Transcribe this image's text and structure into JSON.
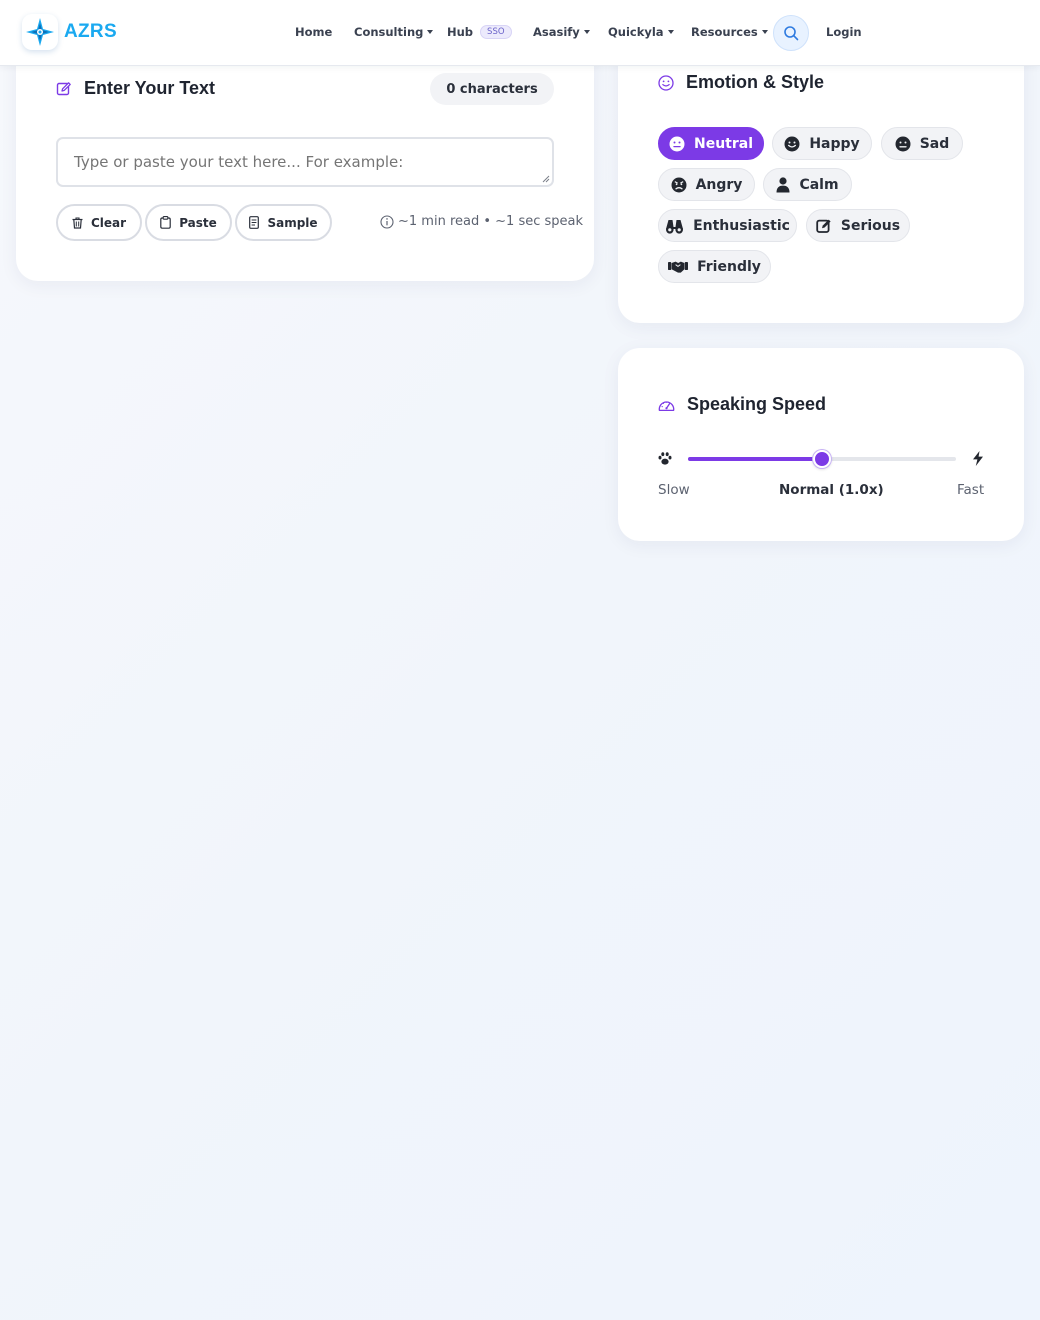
{
  "brand": {
    "name": "AZRS"
  },
  "nav": {
    "home": "Home",
    "consulting": "Consulting",
    "hub": "Hub",
    "hub_badge": "SSO",
    "asasify": "Asasify",
    "quickyla": "Quickyla",
    "resources": "Resources",
    "login": "Login"
  },
  "text_card": {
    "title": "Enter Your Text",
    "char_count": "0 characters",
    "placeholder": "Type or paste your text here... For example:",
    "buttons": {
      "clear": "Clear",
      "paste": "Paste",
      "sample": "Sample"
    },
    "read_info": "~1 min read • ~1 sec speak"
  },
  "emotion_card": {
    "title": "Emotion & Style",
    "selected": "Neutral",
    "options": [
      {
        "label": "Neutral",
        "icon": "neutral-face-icon"
      },
      {
        "label": "Happy",
        "icon": "smile-face-icon"
      },
      {
        "label": "Sad",
        "icon": "sad-face-icon"
      },
      {
        "label": "Angry",
        "icon": "angry-face-icon"
      },
      {
        "label": "Calm",
        "icon": "person-icon"
      },
      {
        "label": "Enthusiastic",
        "icon": "binoculars-icon"
      },
      {
        "label": "Serious",
        "icon": "edit-icon"
      },
      {
        "label": "Friendly",
        "icon": "handshake-icon"
      }
    ]
  },
  "speed_card": {
    "title": "Speaking Speed",
    "min_label": "Slow",
    "current_label": "Normal (1.0x)",
    "max_label": "Fast",
    "value_fraction": 0.5
  },
  "colors": {
    "accent": "#7c3ae6",
    "brand": "#1aa9f0",
    "card_bg": "#ffffff",
    "page_bg": "#f3f6fb"
  }
}
